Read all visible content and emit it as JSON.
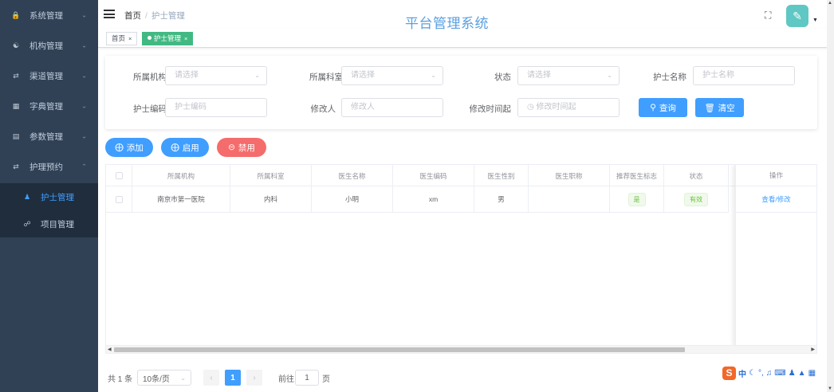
{
  "sidebar": {
    "items": [
      {
        "label": "系统管理",
        "icon": "lock-icon"
      },
      {
        "label": "机构管理",
        "icon": "org-tree-icon"
      },
      {
        "label": "渠道管理",
        "icon": "channel-icon"
      },
      {
        "label": "字典管理",
        "icon": "dictionary-icon"
      },
      {
        "label": "参数管理",
        "icon": "params-icon"
      },
      {
        "label": "护理预约",
        "icon": "appointment-icon"
      }
    ],
    "sub_items": [
      {
        "label": "护士管理",
        "icon": "user-icon",
        "active": true
      },
      {
        "label": "项目管理",
        "icon": "link-icon",
        "active": false
      }
    ]
  },
  "navbar": {
    "breadcrumb": [
      "首页",
      "护士管理"
    ],
    "system_title": "平台管理系统"
  },
  "tags": [
    {
      "label": "首页",
      "active": false
    },
    {
      "label": "护士管理",
      "active": true
    }
  ],
  "filter": {
    "org_label": "所属机构",
    "org_placeholder": "请选择",
    "dept_label": "所属科室",
    "dept_placeholder": "请选择",
    "status_label": "状态",
    "status_placeholder": "请选择",
    "nurse_name_label": "护士名称",
    "nurse_name_placeholder": "护士名称",
    "nurse_code_label": "护士编码",
    "nurse_code_placeholder": "护士编码",
    "modifier_label": "修改人",
    "modifier_placeholder": "修改人",
    "modtime_label": "修改时间起",
    "modtime_placeholder": "修改时间起",
    "search_label": "查询",
    "clear_label": "清空"
  },
  "actions": {
    "add": "添加",
    "enable": "启用",
    "disable": "禁用"
  },
  "table": {
    "headers": [
      "所属机构",
      "所属科室",
      "医生名称",
      "医生编码",
      "医生性别",
      "医生职称",
      "推荐医生标志",
      "状态",
      "操作"
    ],
    "rows": [
      {
        "org": "南京市第一医院",
        "dept": "内科",
        "name": "小明",
        "code": "xm",
        "gender": "男",
        "title": "",
        "recommend": "是",
        "status": "有效",
        "op": "查看/修改"
      }
    ]
  },
  "pagination": {
    "total": "共 1 条",
    "page_size": "10条/页",
    "current_page": "1",
    "goto_label": "前往",
    "goto_value": "1",
    "page_suffix": "页"
  },
  "colors": {
    "primary": "#409eff",
    "danger": "#f56c6c",
    "sidebar": "#304156",
    "tag_active": "#42b983"
  }
}
